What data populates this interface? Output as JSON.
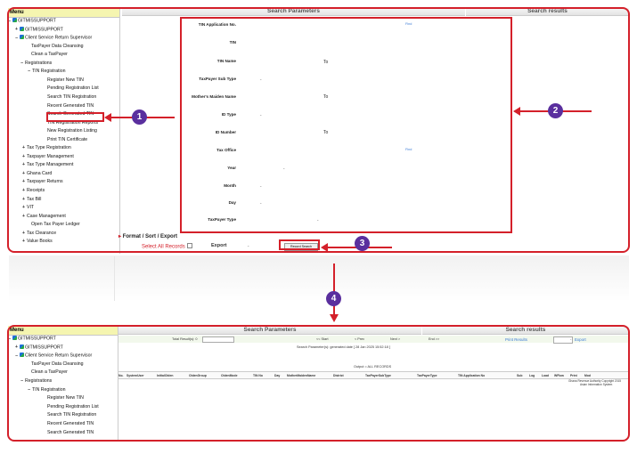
{
  "top": {
    "menu_label": "Menu",
    "search_params_title": "Search Parameters",
    "search_results_title": "Search results",
    "tree": [
      {
        "sign": "−",
        "icon": true,
        "label": "GITMISSUPPORT"
      },
      {
        "sign": "+",
        "icon": true,
        "label": "GITMISSUPPORT"
      },
      {
        "sign": "−",
        "icon": true,
        "label": "Client Service Return Supervisor"
      },
      {
        "sign": "",
        "icon": false,
        "label": "TaxPayer Data Cleansing"
      },
      {
        "sign": "",
        "icon": false,
        "label": "Clean a TaxPayer"
      },
      {
        "sign": "−",
        "icon": false,
        "label": "Registrations"
      },
      {
        "sign": "−",
        "icon": false,
        "label": "TIN Registration"
      },
      {
        "sign": "",
        "icon": false,
        "label": "Register New TIN"
      },
      {
        "sign": "",
        "icon": false,
        "label": "Pending Registration List"
      },
      {
        "sign": "",
        "icon": false,
        "label": "Search TIN Registration"
      },
      {
        "sign": "",
        "icon": false,
        "label": "Recent Generated TIN"
      },
      {
        "sign": "",
        "icon": false,
        "label": "Search Generated TIN"
      },
      {
        "sign": "",
        "icon": false,
        "label": "TIN Registration Reports"
      },
      {
        "sign": "",
        "icon": false,
        "label": "New Registration Listing"
      },
      {
        "sign": "",
        "icon": false,
        "label": "Print TIN Certificate"
      },
      {
        "sign": "+",
        "icon": false,
        "label": "Tax Type Registration"
      },
      {
        "sign": "+",
        "icon": false,
        "label": "Taxpayer Management"
      },
      {
        "sign": "+",
        "icon": false,
        "label": "Tax Type Management"
      },
      {
        "sign": "+",
        "icon": false,
        "label": "Ghana Card"
      },
      {
        "sign": "+",
        "icon": false,
        "label": "Taxpayer Returns"
      },
      {
        "sign": "+",
        "icon": false,
        "label": "Receipts"
      },
      {
        "sign": "+",
        "icon": false,
        "label": "Tax Bill"
      },
      {
        "sign": "+",
        "icon": false,
        "label": "VIT"
      },
      {
        "sign": "+",
        "icon": false,
        "label": "Case Management"
      },
      {
        "sign": "",
        "icon": false,
        "label": "Open Tax Payer Ledger"
      },
      {
        "sign": "+",
        "icon": false,
        "label": "Tax Clearance"
      },
      {
        "sign": "+",
        "icon": false,
        "label": "Value Books"
      }
    ],
    "fields": {
      "tin_application_no": "TIN Application No.",
      "tin": "TIN",
      "tin_name": "TIN Name",
      "taxpayer_sub_type": "TaxPayer Sub Type",
      "mothers_maiden_name": "Mother's Maiden Name",
      "id_type": "ID Type",
      "id_number": "ID Number",
      "tax_office": "Tax Office",
      "year": "Year",
      "month": "Month",
      "day": "Day",
      "taxpayer_type": "TaxPayer Type"
    },
    "to_label": "To",
    "find_label": "Find",
    "format_sort_export": "Format / Sort / Export",
    "select_all_records": "Select All Records",
    "export_label": "Export",
    "record_search_button": "Record Search"
  },
  "bottom": {
    "menu_label": "Menu",
    "search_params_title": "Search Parameters",
    "search_results_title": "Search results",
    "tree": [
      {
        "sign": "−",
        "icon": true,
        "label": "GITMISSUPPORT"
      },
      {
        "sign": "+",
        "icon": true,
        "label": "GITMISSUPPORT"
      },
      {
        "sign": "−",
        "icon": true,
        "label": "Client Service Return Supervisor"
      },
      {
        "sign": "",
        "icon": false,
        "label": "TaxPayer Data Cleansing"
      },
      {
        "sign": "",
        "icon": false,
        "label": "Clean a TaxPayer"
      },
      {
        "sign": "−",
        "icon": false,
        "label": "Registrations"
      },
      {
        "sign": "−",
        "icon": false,
        "label": "TIN Registration"
      },
      {
        "sign": "",
        "icon": false,
        "label": "Register New TIN"
      },
      {
        "sign": "",
        "icon": false,
        "label": "Pending Registration List"
      },
      {
        "sign": "",
        "icon": false,
        "label": "Search TIN Registration"
      },
      {
        "sign": "",
        "icon": false,
        "label": "Recent Generated TIN"
      },
      {
        "sign": "",
        "icon": false,
        "label": "Search Generated TIN"
      }
    ],
    "total_results": "Total Result(s): 0",
    "pager": {
      "start": "<< Start",
      "prev": "< Prev",
      "next": "Next >",
      "end": "End >>"
    },
    "print_results": "Print Results",
    "export_label": "Export",
    "search_params_line": "Search Parameter(s): generated date [ 28 Jan 2025 15:52:18 ]",
    "output_line": "Output = ALL RECORDS",
    "columns": [
      "No.",
      "SystemUser",
      "InitialOlden",
      "OldenGroup",
      "OldenMode",
      "TIN No",
      "Day",
      "MotherMaidenName",
      "District",
      "TaxPayerSubType",
      "TaxPayerType",
      "TIN Application No",
      "Sub",
      "Log",
      "Load",
      "WFlow",
      "Print",
      "Mod"
    ],
    "footer_lines": [
      "Ghana Revenue Authority Copyright 2015",
      "Asian Information System"
    ]
  },
  "callouts": [
    "1",
    "2",
    "3",
    "4"
  ]
}
